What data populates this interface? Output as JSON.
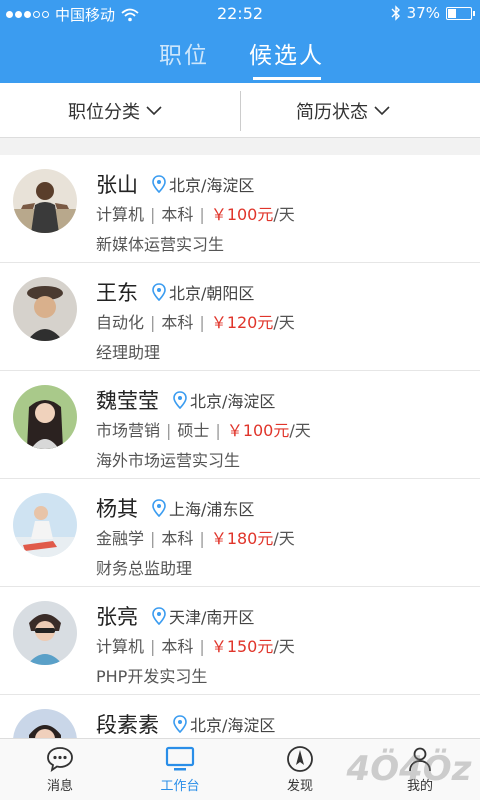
{
  "status_bar": {
    "carrier": "中国移动",
    "time": "22:52",
    "battery": "37%",
    "battery_level": 0.37
  },
  "tabs": [
    {
      "label": "职位",
      "active": false
    },
    {
      "label": "候选人",
      "active": true
    }
  ],
  "filters": [
    {
      "label": "职位分类"
    },
    {
      "label": "简历状态"
    }
  ],
  "candidates": [
    {
      "name": "张山",
      "location": "北京/海淀区",
      "major": "计算机",
      "degree": "本科",
      "salary": "￥100元",
      "unit": "/天",
      "job": "新媒体运营实习生"
    },
    {
      "name": "王东",
      "location": "北京/朝阳区",
      "major": "自动化",
      "degree": "本科",
      "salary": "￥120元",
      "unit": "/天",
      "job": "经理助理"
    },
    {
      "name": "魏莹莹",
      "location": "北京/海淀区",
      "major": "市场营销",
      "degree": "硕士",
      "salary": "￥100元",
      "unit": "/天",
      "job": "海外市场运营实习生"
    },
    {
      "name": "杨其",
      "location": "上海/浦东区",
      "major": "金融学",
      "degree": "本科",
      "salary": "￥180元",
      "unit": "/天",
      "job": "财务总监助理"
    },
    {
      "name": "张亮",
      "location": "天津/南开区",
      "major": "计算机",
      "degree": "本科",
      "salary": "￥150元",
      "unit": "/天",
      "job": "PHP开发实习生"
    },
    {
      "name": "段素素",
      "location": "北京/海淀区",
      "major": "",
      "degree": "",
      "salary": "",
      "unit": "",
      "job": ""
    }
  ],
  "bottom_nav": [
    {
      "label": "消息",
      "icon": "message-icon",
      "active": false
    },
    {
      "label": "工作台",
      "icon": "monitor-icon",
      "active": true
    },
    {
      "label": "发现",
      "icon": "compass-icon",
      "active": false
    },
    {
      "label": "我的",
      "icon": "person-icon",
      "active": false
    }
  ],
  "watermark": "4Ö4Öz",
  "colors": {
    "header": "#3b9cf0",
    "salary": "#e0352b",
    "nav_active": "#2a8ee8"
  }
}
